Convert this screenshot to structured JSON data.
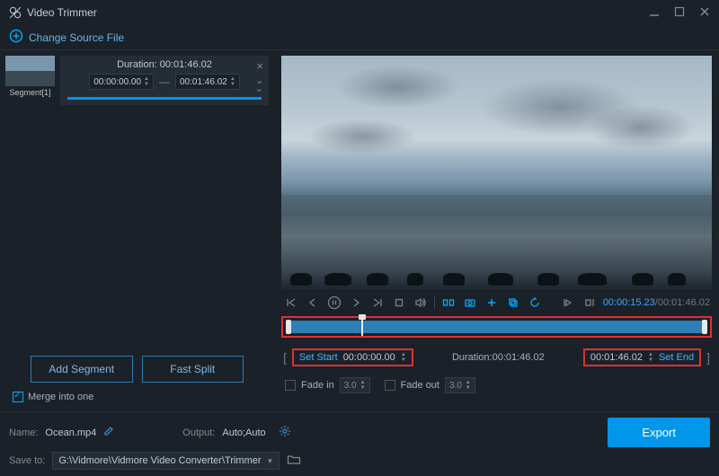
{
  "title": "Video Trimmer",
  "header": {
    "change_source": "Change Source File"
  },
  "segment": {
    "thumb_label": "Segment[1]",
    "duration_label": "Duration:",
    "duration_value": "00:01:46.02",
    "start_tc": "00:00:00.00",
    "end_tc": "00:01:46.02"
  },
  "buttons": {
    "add_segment": "Add Segment",
    "fast_split": "Fast Split",
    "export": "Export"
  },
  "merge": {
    "label": "Merge into one",
    "checked": true
  },
  "playback": {
    "current": "00:00:15.23",
    "total": "00:01:46.02"
  },
  "set_row": {
    "set_start_label": "Set Start",
    "start_tc": "00:00:00.00",
    "duration_label": "Duration:",
    "duration_value": "00:01:46.02",
    "end_tc": "00:01:46.02",
    "set_end_label": "Set End"
  },
  "fade": {
    "in_label": "Fade in",
    "in_val": "3.0",
    "out_label": "Fade out",
    "out_val": "3.0"
  },
  "footer": {
    "name_label": "Name:",
    "name_val": "Ocean.mp4",
    "output_label": "Output:",
    "output_val": "Auto;Auto",
    "save_label": "Save to:",
    "save_path": "G:\\Vidmore\\Vidmore Video Converter\\Trimmer"
  }
}
